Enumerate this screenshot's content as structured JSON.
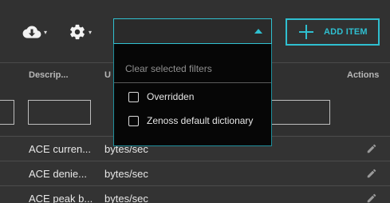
{
  "toolbar": {
    "cloud_icon": "cloud-download-icon",
    "gear_icon": "gear-icon",
    "caret": "▾",
    "add_label": "ADD ITEM"
  },
  "filter": {
    "value": "",
    "options_clear": "Clear selected filters",
    "options": [
      {
        "label": "Overridden",
        "checked": false
      },
      {
        "label": "Zenoss default dictionary",
        "checked": false
      }
    ]
  },
  "table": {
    "headers": {
      "description": "Descrip...",
      "units": "U",
      "actions": "Actions"
    },
    "rows": [
      {
        "description": "ACE curren...",
        "units": "bytes/sec"
      },
      {
        "description": "ACE denie...",
        "units": "bytes/sec"
      },
      {
        "description": "ACE peak b...",
        "units": "bytes/sec"
      }
    ]
  },
  "colors": {
    "accent": "#2fbfd0",
    "background": "#303030",
    "dropdown_bg": "#060606"
  }
}
